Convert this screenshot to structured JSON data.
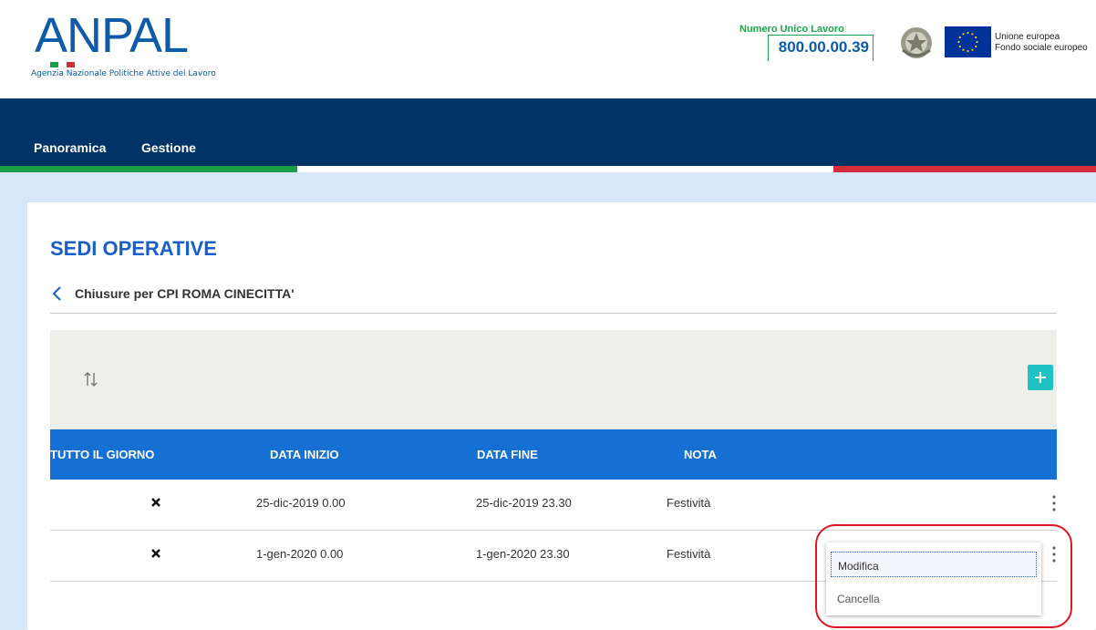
{
  "header": {
    "logo_text": "ANPAL",
    "logo_subtitle": "Agenzia Nazionale Politiche Attive del Lavoro",
    "hotline_label": "Numero Unico Lavoro",
    "hotline_number": "800.00.00.39",
    "eu_line1": "Unione europea",
    "eu_line2": "Fondo sociale europeo",
    "colors": {
      "brand_blue": "#0e5ba8",
      "green": "#1aa64a"
    }
  },
  "nav": {
    "items": [
      {
        "label": "Panoramica"
      },
      {
        "label": "Gestione"
      }
    ],
    "colors": {
      "background": "#003366",
      "green": "#1a9e46",
      "white": "#ffffff",
      "red": "#d62c3a"
    }
  },
  "page": {
    "title": "SEDI OPERATIVE",
    "breadcrumb": "Chiusure per CPI ROMA CINECITTA'",
    "toolbar": {
      "sort_icon": "sort-arrows-icon",
      "add_icon": "plus-icon"
    }
  },
  "table": {
    "columns": [
      "TUTTO IL GIORNO",
      "DATA INIZIO",
      "DATA FINE",
      "NOTA"
    ],
    "rows": [
      {
        "tutto_il_giorno": "x-icon",
        "data_inizio": "25-dic-2019 0.00",
        "data_fine": "25-dic-2019 23.30",
        "nota": "Festività"
      },
      {
        "tutto_il_giorno": "x-icon",
        "data_inizio": "1-gen-2020 0.00",
        "data_fine": "1-gen-2020 23.30",
        "nota": "Festività"
      }
    ],
    "header_color": "#1670d4"
  },
  "context_menu": {
    "items": [
      {
        "label": "Modifica"
      },
      {
        "label": "Cancella"
      }
    ]
  }
}
